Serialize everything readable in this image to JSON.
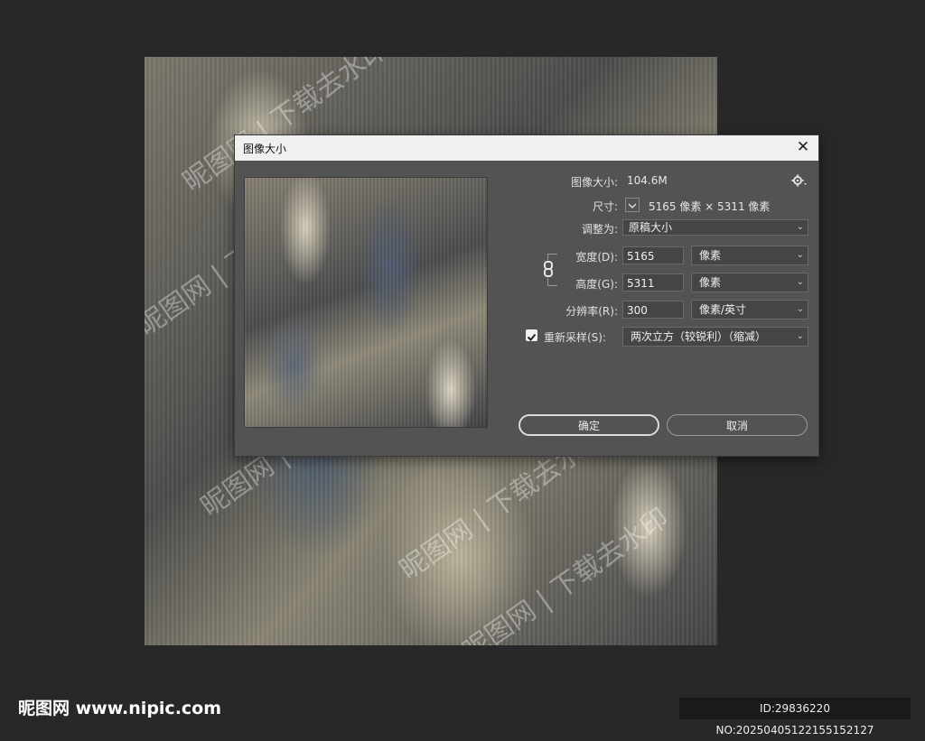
{
  "watermark_text": "昵图网 | 下载去水印",
  "dialog": {
    "title": "图像大小",
    "close_glyph": "✕",
    "image_size_label": "图像大小:",
    "image_size_value": "104.6M",
    "settings_icon": "gear-icon",
    "dimensions_label": "尺寸:",
    "dimensions_value": "5165 像素 × 5311 像素",
    "fit_to_label": "调整为:",
    "fit_to_value": "原稿大小",
    "width_label": "宽度(D):",
    "width_value": "5165",
    "width_unit": "像素",
    "height_label": "高度(G):",
    "height_value": "5311",
    "height_unit": "像素",
    "resolution_label": "分辨率(R):",
    "resolution_value": "300",
    "resolution_unit": "像素/英寸",
    "resample_label": "重新采样(S):",
    "resample_checked": true,
    "resample_value": "两次立方（较锐利）（缩减）",
    "ok_label": "确定",
    "cancel_label": "取消"
  },
  "footer": {
    "logo": "昵图网 www.nipic.com",
    "id_text": "ID:29836220 NO:20250405122155152127"
  }
}
